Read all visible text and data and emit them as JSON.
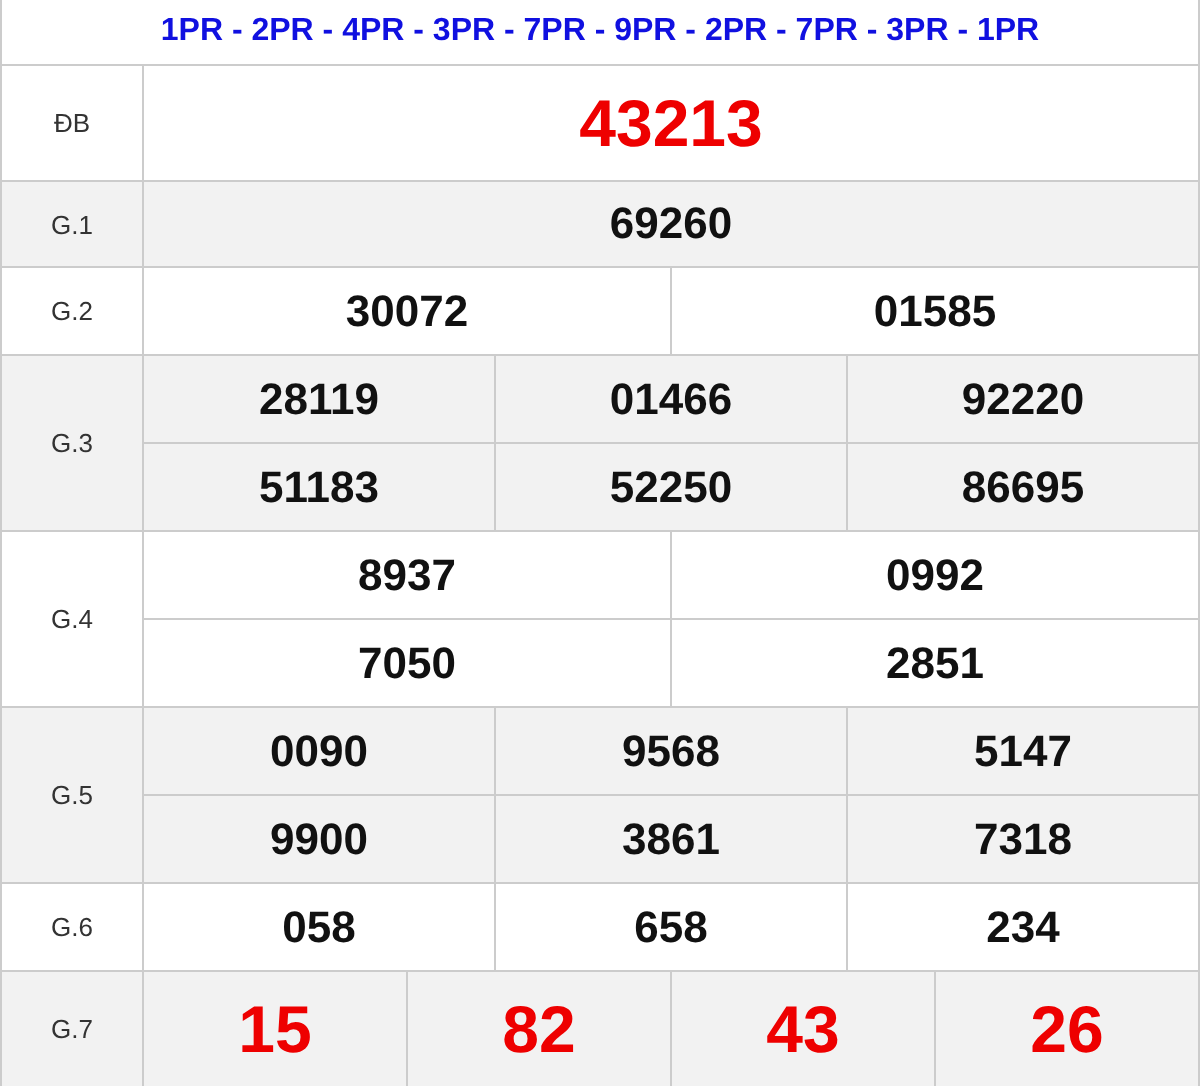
{
  "header": {
    "sequence": "1PR - 2PR - 4PR - 3PR - 7PR - 9PR - 2PR - 7PR - 3PR - 1PR"
  },
  "prizes": [
    {
      "label": "ĐB",
      "kind": "highlight",
      "lines": [
        [
          "43213"
        ]
      ]
    },
    {
      "label": "G.1",
      "kind": "plain",
      "lines": [
        [
          "69260"
        ]
      ]
    },
    {
      "label": "G.2",
      "kind": "plain",
      "lines": [
        [
          "30072",
          "01585"
        ]
      ]
    },
    {
      "label": "G.3",
      "kind": "plain",
      "lines": [
        [
          "28119",
          "01466",
          "92220"
        ],
        [
          "51183",
          "52250",
          "86695"
        ]
      ]
    },
    {
      "label": "G.4",
      "kind": "plain",
      "lines": [
        [
          "8937",
          "0992"
        ],
        [
          "7050",
          "2851"
        ]
      ]
    },
    {
      "label": "G.5",
      "kind": "plain",
      "lines": [
        [
          "0090",
          "9568",
          "5147"
        ],
        [
          "9900",
          "3861",
          "7318"
        ]
      ]
    },
    {
      "label": "G.6",
      "kind": "plain",
      "lines": [
        [
          "058",
          "658",
          "234"
        ]
      ]
    },
    {
      "label": "G.7",
      "kind": "highlight",
      "lines": [
        [
          "15",
          "82",
          "43",
          "26"
        ]
      ]
    }
  ]
}
